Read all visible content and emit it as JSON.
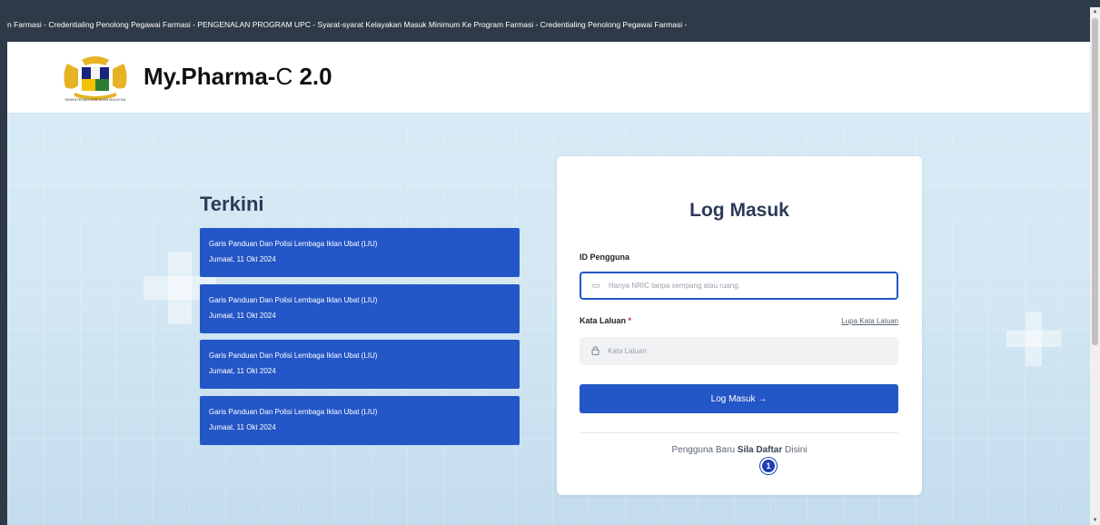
{
  "ticker": {
    "text": "n Farmasi - Credentialing Penolong Pegawai Farmasi - PENGENALAN PROGRAM UPC - Syarat-syarat Kelayakan Masuk Minimum Ke Program Farmasi - Credentialing Penolong Pegawai Farmasi -"
  },
  "header": {
    "brand_main": "My.Pharma-",
    "brand_thin": "C ",
    "brand_version": "2.0",
    "logo_caption": "KEMENTERIAN KESIHATAN MALAYSIA"
  },
  "terkini": {
    "title": "Terkini",
    "items": [
      {
        "title": "Garis Panduan Dan Polisi Lembaga Iklan Ubat (LIU)",
        "date": "Jumaat, 11 Okt 2024"
      },
      {
        "title": "Garis Panduan Dan Polisi Lembaga Iklan Ubat (LIU)",
        "date": "Jumaat, 11 Okt 2024"
      },
      {
        "title": "Garis Panduan Dan Polisi Lembaga Iklan Ubat (LIU)",
        "date": "Jumaat, 11 Okt 2024"
      },
      {
        "title": "Garis Panduan Dan Polisi Lembaga Iklan Ubat (LIU)",
        "date": "Jumaat, 11 Okt 2024"
      }
    ]
  },
  "login": {
    "title": "Log Masuk",
    "id_label": "ID Pengguna",
    "id_placeholder": "Hanya NRIC tanpa sempang atau ruang.",
    "password_label": "Kata Laluan",
    "required_mark": "*",
    "forgot_label": "Lupa Kata Laluan",
    "password_placeholder": "Kata Laluan",
    "submit_label": "Log Masuk →",
    "register_prefix": "Pengguna Baru",
    "register_link": "Sila Daftar",
    "register_suffix": "Disini",
    "badge": "1"
  },
  "icons": {
    "id": "id-card-icon",
    "password": "lock-icon"
  },
  "colors": {
    "primary": "#2356c6",
    "ticker_bg": "#2e3a47",
    "title": "#2e3a58"
  }
}
